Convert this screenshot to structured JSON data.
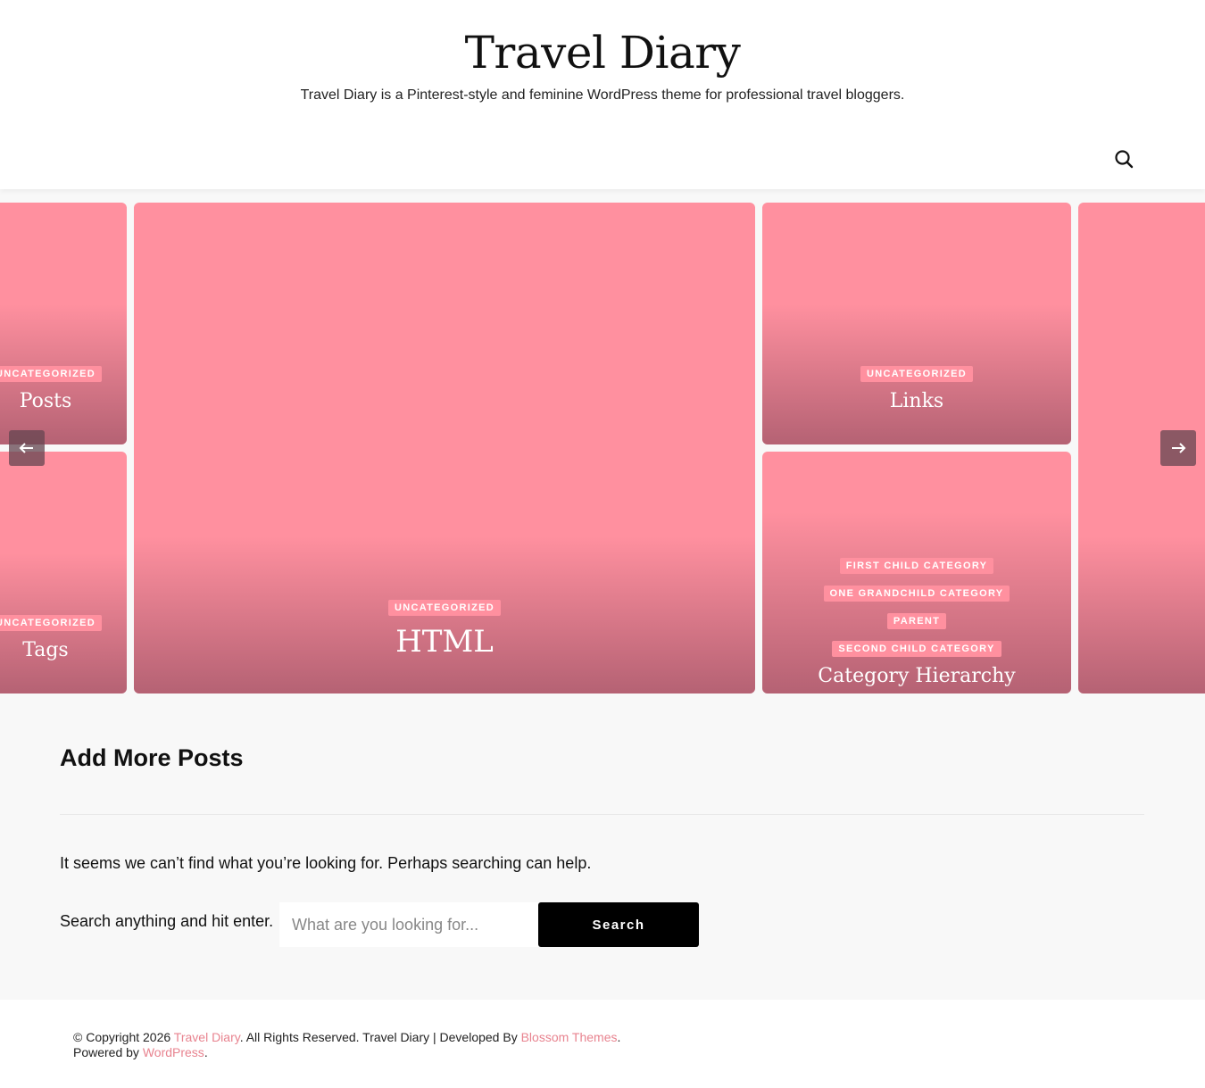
{
  "header": {
    "site_title": "Travel Diary",
    "site_description": "Travel Diary is a Pinterest-style and feminine WordPress theme for professional travel bloggers."
  },
  "slider": {
    "left_top": {
      "category": "UNCATEGORIZED",
      "title": "Posts"
    },
    "left_bottom": {
      "category": "UNCATEGORIZED",
      "title": "Tags"
    },
    "main": {
      "category": "UNCATEGORIZED",
      "title": "HTML"
    },
    "right_top": {
      "category": "UNCATEGORIZED",
      "title": "Links"
    },
    "right_bottom": {
      "categories": [
        "FIRST CHILD CATEGORY",
        "ONE GRANDCHILD CATEGORY",
        "PARENT",
        "SECOND CHILD CATEGORY"
      ],
      "title": "Category Hierarchy"
    }
  },
  "content": {
    "heading": "Add More Posts",
    "not_found_message": "It seems we can’t find what you’re looking for. Perhaps searching can help.",
    "search_label": "Search anything and hit enter.",
    "search_placeholder": "What are you looking for...",
    "search_button": "Search"
  },
  "footer": {
    "copyright": "© Copyright 2026 ",
    "site_link": "Travel Diary",
    "rights": ". All Rights Reserved. Travel Diary | Developed By ",
    "developer_link": "Blossom Themes",
    "powered": ". Powered by ",
    "wp_link": "WordPress",
    "end": "."
  },
  "colors": {
    "card_pink": "#ff909f",
    "link_pink": "#e8838f",
    "button_black": "#000000"
  },
  "icons": {
    "search_toggle": "search-icon",
    "prev": "arrow-left-icon",
    "next": "arrow-right-icon"
  }
}
